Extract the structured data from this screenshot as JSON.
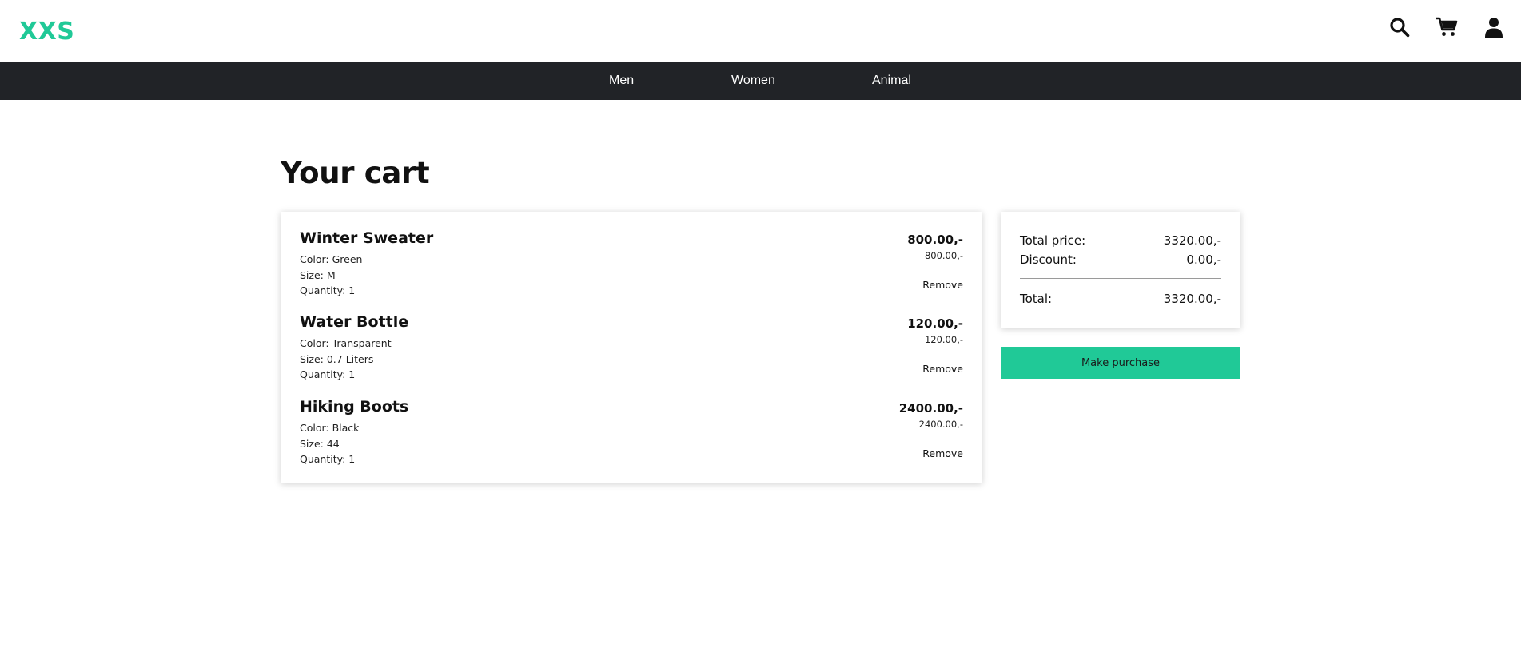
{
  "header": {
    "logo": "XXS",
    "icons": [
      "search-icon",
      "cart-icon",
      "user-icon"
    ]
  },
  "nav": {
    "items": [
      "Men",
      "Women",
      "Animal"
    ]
  },
  "main": {
    "title": "Your cart"
  },
  "cart": {
    "items": [
      {
        "name": "Winter Sweater",
        "color": "Color: Green",
        "size": "Size: M",
        "quantity": "Quantity: 1",
        "price": "800.00,-",
        "unit_price": "800.00,-",
        "remove_label": "Remove"
      },
      {
        "name": "Water Bottle",
        "color": "Color: Transparent",
        "size": "Size: 0.7 Liters",
        "quantity": "Quantity: 1",
        "price": "120.00,-",
        "unit_price": "120.00,-",
        "remove_label": "Remove"
      },
      {
        "name": "Hiking Boots",
        "color": "Color: Black",
        "size": "Size: 44",
        "quantity": "Quantity: 1",
        "price": "2400.00,-",
        "unit_price": "2400.00,-",
        "remove_label": "Remove"
      }
    ]
  },
  "summary": {
    "total_price_label": "Total price:",
    "total_price_value": "3320.00,-",
    "discount_label": "Discount:",
    "discount_value": "0.00,-",
    "total_label": "Total:",
    "total_value": "3320.00,-"
  },
  "actions": {
    "purchase_label": "Make purchase"
  },
  "colors": {
    "accent": "#20c997",
    "navbar": "#212327"
  }
}
